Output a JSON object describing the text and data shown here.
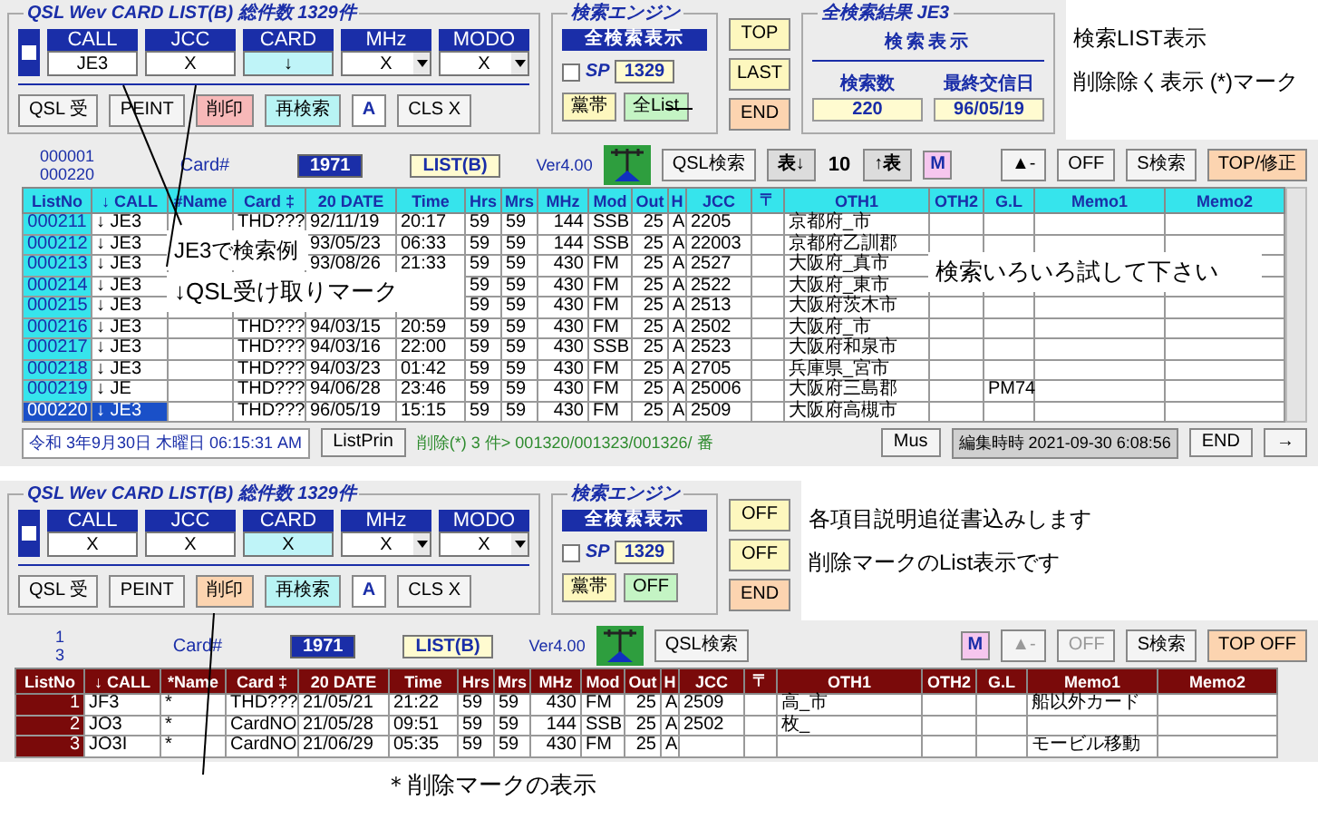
{
  "views": [
    {
      "form": {
        "title": "QSL Wev CARD LIST(B) 総件数  1329件",
        "checked": false,
        "fields": [
          {
            "label": "CALL",
            "value": "JE3",
            "spinner": false,
            "selected": false
          },
          {
            "label": "JCC",
            "value": "X",
            "spinner": false,
            "selected": false
          },
          {
            "label": "CARD",
            "value": "↓",
            "spinner": false,
            "selected": true
          },
          {
            "label": "MHz",
            "value": "X",
            "spinner": true,
            "selected": false
          },
          {
            "label": "MODO",
            "value": "X",
            "spinner": true,
            "selected": false
          }
        ],
        "buttons": [
          {
            "label": "QSL 受",
            "kind": "plain"
          },
          {
            "label": "PEINT",
            "kind": "plain"
          },
          {
            "label": "削印",
            "kind": "red"
          },
          {
            "label": "再検索",
            "kind": "cyan"
          },
          {
            "label": "A",
            "kind": "blue"
          },
          {
            "label": "CLS X",
            "kind": "plain"
          }
        ],
        "engine": {
          "title": "検索エンジン",
          "header": "全検索表示",
          "sp_checked": false,
          "sp_label": "SP",
          "count": "1329",
          "buttons": [
            {
              "label": "黨帯",
              "kind": "yellow"
            },
            {
              "label": "全List",
              "kind": "green"
            }
          ]
        },
        "side_buttons": [
          {
            "label": "TOP",
            "kind": "yellow"
          },
          {
            "label": "LAST",
            "kind": "yellow"
          },
          {
            "label": "END",
            "kind": "orange"
          }
        ],
        "results": {
          "title": "全検索結果  JE3",
          "header": "検索表示",
          "labels": [
            "検索数",
            "最終交信日"
          ],
          "values": [
            "220",
            "96/05/19"
          ]
        },
        "notes": [
          "検索LIST表示",
          "削除除く表示 (*)マーク"
        ]
      },
      "list": {
        "kind": "search",
        "counts": [
          "000001",
          "000220"
        ],
        "card_label": "Card#",
        "card_value": "1971",
        "list_label": "LIST(B)",
        "version": "Ver4.00",
        "tools": [
          {
            "label": "QSL検索",
            "kind": "plain",
            "disabled": false
          },
          {
            "label": "表↓",
            "kind": "gray",
            "disabled": false
          },
          {
            "label": "10",
            "kind": "text",
            "disabled": false
          },
          {
            "label": "↑表",
            "kind": "gray",
            "disabled": false
          },
          {
            "label": "M",
            "kind": "pink",
            "disabled": false
          }
        ],
        "tools_right": [
          {
            "label": "▲-",
            "kind": "plain",
            "disabled": false
          },
          {
            "label": "OFF",
            "kind": "plain",
            "disabled": false
          },
          {
            "label": "S検索",
            "kind": "plain",
            "disabled": false
          },
          {
            "label": "TOP/修正",
            "kind": "orange",
            "disabled": false
          }
        ],
        "columns": [
          "ListNo",
          "↓ CALL",
          "#Name",
          "Card ‡",
          "20 DATE",
          "Time",
          "Hrs",
          "Mrs",
          "MHz",
          "Mod",
          "Out",
          "H",
          "JCC",
          "〒",
          "OTH1",
          "OTH2",
          "G.L",
          "Memo1",
          "Memo2"
        ],
        "rows": [
          {
            "selected": false,
            "cells": [
              "000211",
              "↓ JE3",
              null,
              "THD???",
              "92/11/19",
              "20:17",
              "59",
              "59",
              "144",
              "SSB",
              "25",
              "A",
              "2205",
              null,
              "京都府_市",
              null,
              null,
              null,
              null
            ]
          },
          {
            "selected": false,
            "cells": [
              "000212",
              "↓ JE3",
              null,
              null,
              "93/05/23",
              "06:33",
              "59",
              "59",
              "144",
              "SSB",
              "25",
              "A",
              "22003",
              null,
              "京都府乙訓郡",
              null,
              null,
              null,
              null
            ]
          },
          {
            "selected": false,
            "cells": [
              "000213",
              "↓ JE3",
              null,
              null,
              "93/08/26",
              "21:33",
              "59",
              "59",
              "430",
              "FM",
              "25",
              "A",
              "2527",
              null,
              "大阪府_真市",
              null,
              null,
              null,
              null
            ]
          },
          {
            "selected": false,
            "cells": [
              "000214",
              "↓ JE3",
              null,
              null,
              null,
              null,
              "59",
              "59",
              "430",
              "FM",
              "25",
              "A",
              "2522",
              null,
              "大阪府_東市",
              null,
              null,
              null,
              null
            ]
          },
          {
            "selected": false,
            "cells": [
              "000215",
              "↓ JE3",
              null,
              null,
              null,
              null,
              "59",
              "59",
              "430",
              "FM",
              "25",
              "A",
              "2513",
              null,
              "大阪府茨木市",
              null,
              null,
              null,
              null
            ]
          },
          {
            "selected": false,
            "cells": [
              "000216",
              "↓ JE3",
              null,
              "THD???",
              "94/03/15",
              "20:59",
              "59",
              "59",
              "430",
              "FM",
              "25",
              "A",
              "2502",
              null,
              "大阪府_市",
              null,
              null,
              null,
              null
            ]
          },
          {
            "selected": false,
            "cells": [
              "000217",
              "↓ JE3",
              null,
              "THD???",
              "94/03/16",
              "22:00",
              "59",
              "59",
              "430",
              "SSB",
              "25",
              "A",
              "2523",
              null,
              "大阪府和泉市",
              null,
              null,
              null,
              null
            ]
          },
          {
            "selected": false,
            "cells": [
              "000218",
              "↓ JE3",
              null,
              "THD???",
              "94/03/23",
              "01:42",
              "59",
              "59",
              "430",
              "FM",
              "25",
              "A",
              "2705",
              null,
              "兵庫県_宮市",
              null,
              null,
              null,
              null
            ]
          },
          {
            "selected": false,
            "cells": [
              "000219",
              "↓ JE",
              null,
              "THD???",
              "94/06/28",
              "23:46",
              "59",
              "59",
              "430",
              "FM",
              "25",
              "A",
              "25006",
              null,
              "大阪府三島郡",
              null,
              "PM74",
              null,
              null
            ]
          },
          {
            "selected": true,
            "cells": [
              "000220",
              "↓ JE3",
              null,
              "THD???",
              "96/05/19",
              "15:15",
              "59",
              "59",
              "430",
              "FM",
              "25",
              "A",
              "2509",
              null,
              "大阪府高槻市",
              null,
              null,
              null,
              null
            ]
          }
        ],
        "callouts": [
          "JE3で検索例",
          "↓QSL受け取りマーク",
          "検索いろいろ試して下さい"
        ],
        "status": {
          "date": "令和 3年9月30日 木曜日 06:15:31 AM",
          "print_button": "ListPrin",
          "deleted_info": "削除(*) 3 件> 001320/001323/001326/ 番",
          "mus_button": "Mus",
          "edited": "編集時時 2021-09-30 6:08:56",
          "end_button": "END",
          "next_button": "→"
        }
      }
    },
    {
      "form": {
        "title": "QSL Wev CARD LIST(B) 総件数  1329件",
        "checked": false,
        "fields": [
          {
            "label": "CALL",
            "value": "X",
            "spinner": false,
            "selected": false
          },
          {
            "label": "JCC",
            "value": "X",
            "spinner": false,
            "selected": false
          },
          {
            "label": "CARD",
            "value": "X",
            "spinner": false,
            "selected": true
          },
          {
            "label": "MHz",
            "value": "X",
            "spinner": true,
            "selected": false
          },
          {
            "label": "MODO",
            "value": "X",
            "spinner": true,
            "selected": false
          }
        ],
        "buttons": [
          {
            "label": "QSL 受",
            "kind": "plain"
          },
          {
            "label": "PEINT",
            "kind": "plain"
          },
          {
            "label": "削印",
            "kind": "orange"
          },
          {
            "label": "再検索",
            "kind": "cyan"
          },
          {
            "label": "A",
            "kind": "blue"
          },
          {
            "label": "CLS X",
            "kind": "plain"
          }
        ],
        "engine": {
          "title": "検索エンジン",
          "header": "全検索表示",
          "sp_checked": false,
          "sp_label": "SP",
          "count": "1329",
          "buttons": [
            {
              "label": "黨帯",
              "kind": "yellow"
            },
            {
              "label": "OFF",
              "kind": "green"
            }
          ]
        },
        "side_buttons": [
          {
            "label": "OFF",
            "kind": "yellow"
          },
          {
            "label": "OFF",
            "kind": "yellow"
          },
          {
            "label": "END",
            "kind": "orange"
          }
        ],
        "notes": [
          "各項目説明追従書込みします",
          "削除マークのList表示です"
        ]
      },
      "list": {
        "kind": "deleted",
        "counts": [
          "1",
          "3"
        ],
        "card_label": "Card#",
        "card_value": "1971",
        "list_label": "LIST(B)",
        "version": "Ver4.00",
        "tools": [
          {
            "label": "QSL検索",
            "kind": "plain",
            "disabled": false
          }
        ],
        "tools_right": [
          {
            "label": "M",
            "kind": "pink",
            "disabled": false
          },
          {
            "label": "▲-",
            "kind": "plain",
            "disabled": true
          },
          {
            "label": "OFF",
            "kind": "plain",
            "disabled": true
          },
          {
            "label": "S検索",
            "kind": "plain",
            "disabled": false
          },
          {
            "label": "TOP OFF",
            "kind": "orange",
            "disabled": false
          }
        ],
        "columns": [
          "ListNo",
          "↓ CALL",
          "*Name",
          "Card ‡",
          "20 DATE",
          "Time",
          "Hrs",
          "Mrs",
          "MHz",
          "Mod",
          "Out",
          "H",
          "JCC",
          "〒",
          "OTH1",
          "OTH2",
          "G.L",
          "Memo1",
          "Memo2"
        ],
        "rows": [
          {
            "selected": false,
            "cells": [
              "1",
              "JF3",
              "*",
              "THD???",
              "21/05/21",
              "21:22",
              "59",
              "59",
              "430",
              "FM",
              "25",
              "A",
              "2509",
              null,
              "高_市",
              null,
              null,
              "船以外カード",
              null
            ]
          },
          {
            "selected": false,
            "cells": [
              "2",
              "JO3",
              "*",
              "CardNO",
              "21/05/28",
              "09:51",
              "59",
              "59",
              "144",
              "SSB",
              "25",
              "A",
              "2502",
              null,
              "枚_",
              null,
              null,
              null,
              null
            ]
          },
          {
            "selected": false,
            "cells": [
              "3",
              "JO3I",
              "*",
              "CardNO",
              "21/06/29",
              "05:35",
              "59",
              "59",
              "430",
              "FM",
              "25",
              "A",
              null,
              null,
              null,
              null,
              null,
              "モービル移動",
              null
            ]
          }
        ]
      }
    }
  ],
  "footnote": "＊削除マークの表示"
}
